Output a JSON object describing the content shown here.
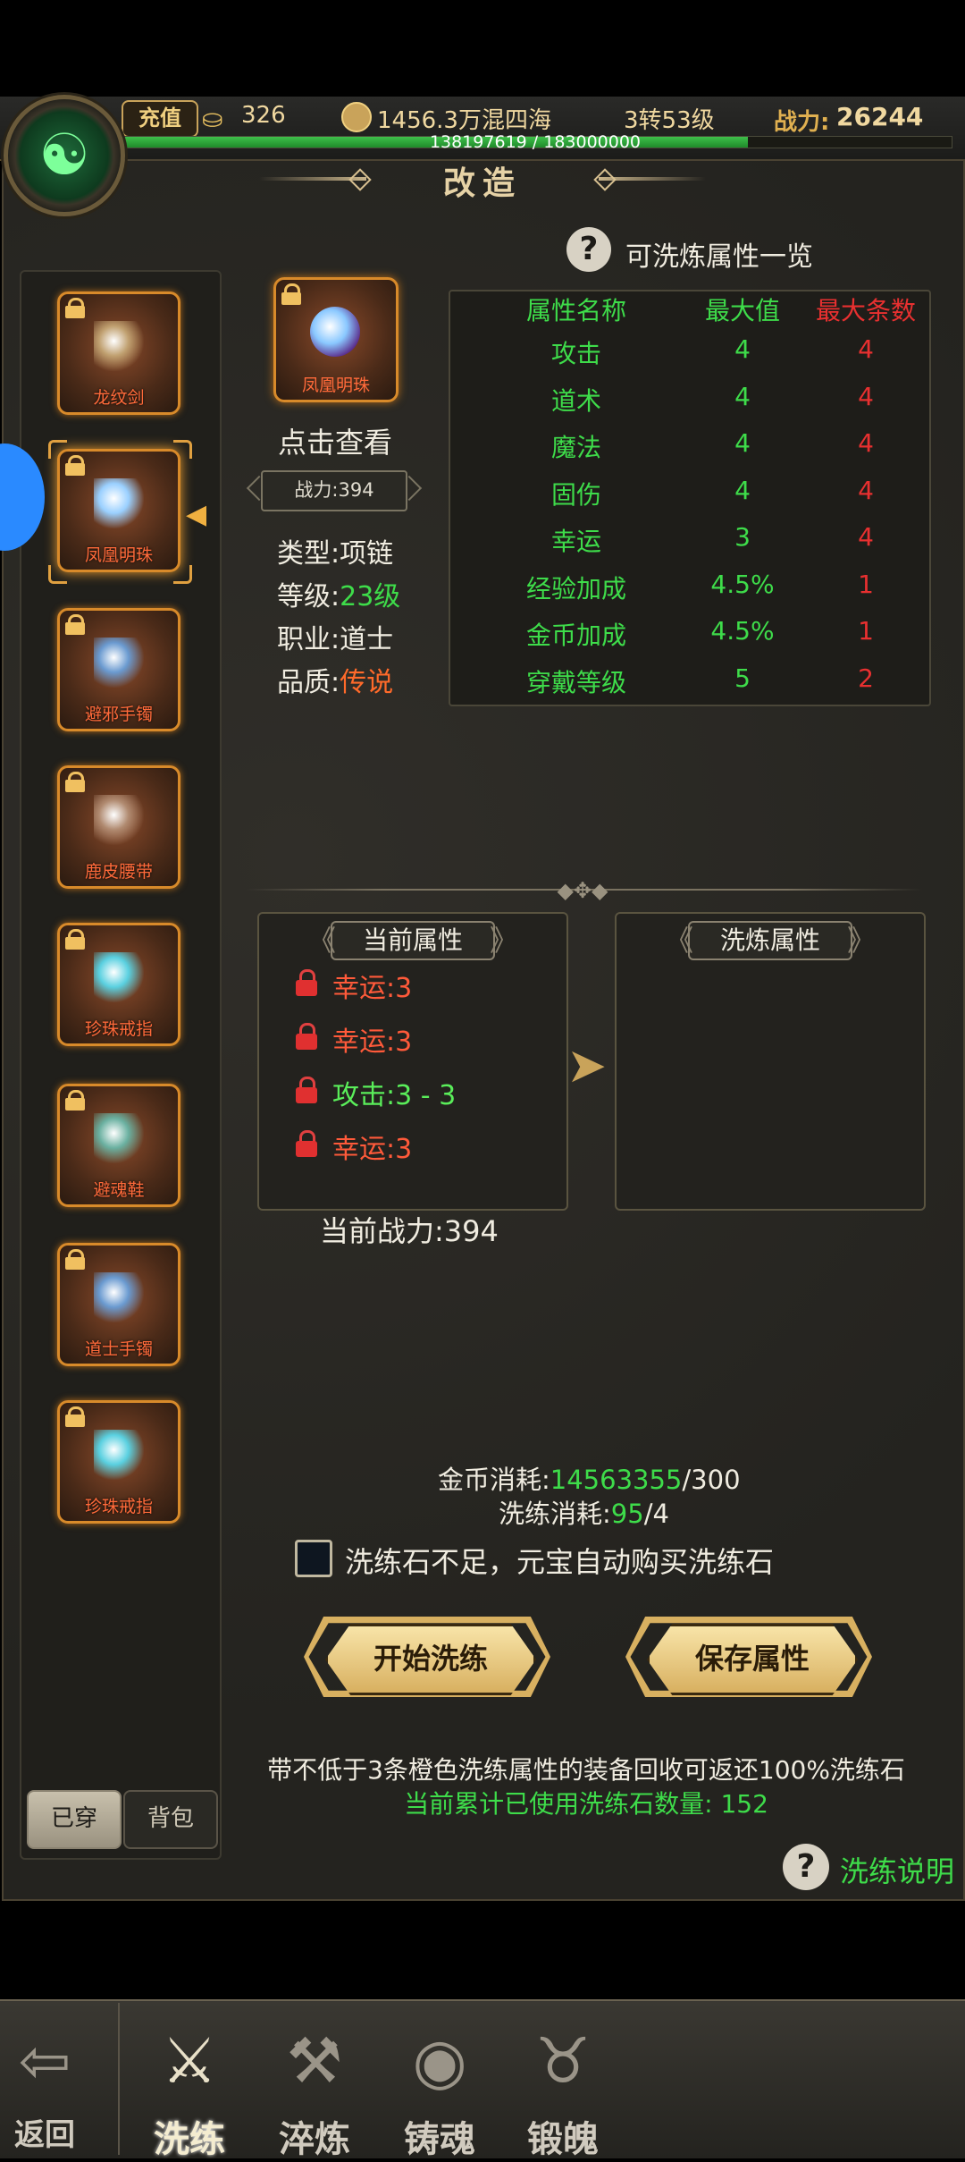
{
  "top": {
    "recharge_label": "充值",
    "ingot_value": "326",
    "coin_value": "1456.3万混四海",
    "level_value": "3转53级",
    "power_label": "战力:",
    "power_value": "26244",
    "exp_text": "138197619 / 183000000",
    "exp_progress": 0.755,
    "taiji_icon": "yin-yang-icon"
  },
  "panel": {
    "title": "改造"
  },
  "equipment_slots": [
    {
      "name": "龙纹剑",
      "gem_color": "#c0a070"
    },
    {
      "name": "凤凰明珠",
      "gem_color": "#9ad0ff"
    },
    {
      "name": "避邪手镯",
      "gem_color": "#6a9ad0"
    },
    {
      "name": "鹿皮腰带",
      "gem_color": "#b08a70"
    },
    {
      "name": "珍珠戒指",
      "gem_color": "#5ad0e0"
    },
    {
      "name": "避魂鞋",
      "gem_color": "#6ab0a0"
    },
    {
      "name": "道士手镯",
      "gem_color": "#6a9ad0"
    },
    {
      "name": "珍珠戒指",
      "gem_color": "#5ad0e0"
    }
  ],
  "tabs": {
    "worn": "已穿",
    "bag": "背包"
  },
  "item": {
    "name": "凤凰明珠",
    "click_view": "点击查看",
    "power": "战力:394",
    "type_label": "类型:",
    "type_value": "项链",
    "level_label": "等级:",
    "level_value": "23级",
    "class_label": "职业:",
    "class_value": "道士",
    "quality_label": "品质:",
    "quality_value": "传说"
  },
  "stats_table": {
    "help_title": "可洗炼属性一览",
    "headers": [
      "属性名称",
      "最大值",
      "最大条数"
    ],
    "rows": [
      [
        "攻击",
        "4",
        "4"
      ],
      [
        "道术",
        "4",
        "4"
      ],
      [
        "魔法",
        "4",
        "4"
      ],
      [
        "固伤",
        "4",
        "4"
      ],
      [
        "幸运",
        "3",
        "4"
      ],
      [
        "经验加成",
        "4.5%",
        "1"
      ],
      [
        "金币加成",
        "4.5%",
        "1"
      ],
      [
        "穿戴等级",
        "5",
        "2"
      ]
    ]
  },
  "attributes": {
    "current_title": "当前属性",
    "wash_title": "洗炼属性",
    "current": [
      {
        "text": "幸运:3",
        "color": "#ff5a3a"
      },
      {
        "text": "幸运:3",
        "color": "#ff5a3a"
      },
      {
        "text": "攻击:3 - 3",
        "color": "#5aee5a"
      },
      {
        "text": "幸运:3",
        "color": "#ff5a3a"
      }
    ],
    "current_power": "当前战力:394"
  },
  "costs": {
    "gold_label": "金币消耗:",
    "gold_have": "14563355",
    "gold_need": "/300",
    "wash_label": "洗练消耗:",
    "wash_have": "95",
    "wash_need": "/4",
    "auto_buy": "洗练石不足，元宝自动购买洗练石",
    "auto_buy_checked": false
  },
  "buttons": {
    "start": "开始洗练",
    "save": "保存属性"
  },
  "notes": {
    "line1": "带不低于3条橙色洗练属性的装备回收可返还100%洗练石",
    "line2": "当前累计已使用洗练石数量:  152",
    "help": "洗练说明"
  },
  "nav": [
    {
      "label": "返回",
      "icon": "back-arrow-icon",
      "glyph": "⇦"
    },
    {
      "label": "洗练",
      "icon": "sword-emblem-icon",
      "glyph": "⚔",
      "active": true
    },
    {
      "label": "淬炼",
      "icon": "axe-emblem-icon",
      "glyph": "⚒"
    },
    {
      "label": "铸魂",
      "icon": "eye-emblem-icon",
      "glyph": "◉"
    },
    {
      "label": "锻魄",
      "icon": "demon-mask-icon",
      "glyph": "♉"
    }
  ],
  "colors": {
    "green_value": "#3edc4a",
    "red_value": "#e83030",
    "orange_quality": "#ff6a2a"
  }
}
